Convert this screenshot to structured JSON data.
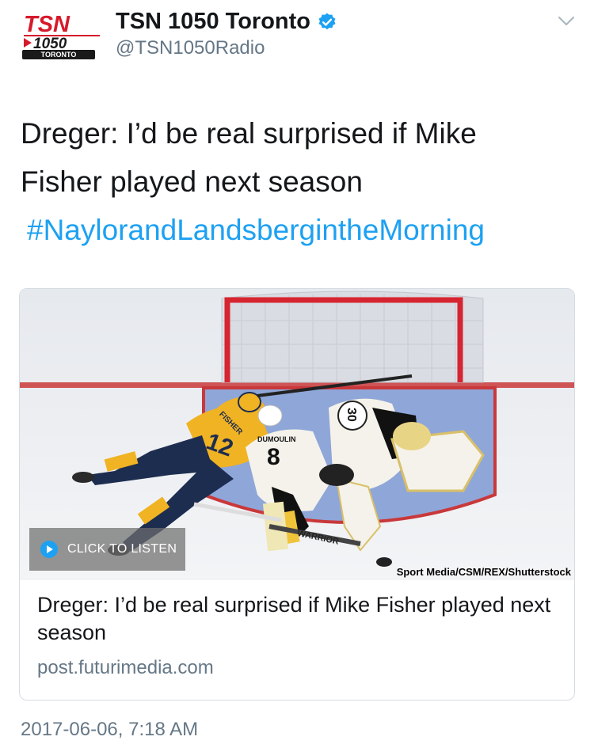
{
  "header": {
    "logo": {
      "brand": "TSN",
      "number": "1050",
      "city": "TORONTO"
    },
    "display_name": "TSN 1050 Toronto",
    "handle": "@TSN1050Radio",
    "verified_icon": "verified-badge-icon",
    "menu_icon": "chevron-down-icon"
  },
  "tweet": {
    "text_lines": [
      "Dreger: I’d be real surprised if Mike",
      "Fisher played next season"
    ],
    "hashtag": "#NaylorandLandsbergintheMorning"
  },
  "card": {
    "image": {
      "description_icon": "hockey-photo",
      "listen_label": "CLICK TO LISTEN",
      "credit": "Sport Media/CSM/REX/Shutterstock",
      "jersey_numbers": [
        "12",
        "8",
        "30"
      ],
      "jersey_names": [
        "FISHER",
        "DUMOULIN"
      ],
      "stick_brand": "WARRIOR"
    },
    "title": "Dreger: I’d be real surprised if Mike Fisher played next season",
    "domain": "post.futurimedia.com"
  },
  "timestamp": "2017-06-06, 7:18 AM",
  "colors": {
    "link_blue": "#1da1f2",
    "secondary_text": "#657786",
    "tsn_red": "#d6192b",
    "predators_gold": "#f0b323",
    "predators_navy": "#1d2d50",
    "crease_blue": "#8fa6d8"
  }
}
